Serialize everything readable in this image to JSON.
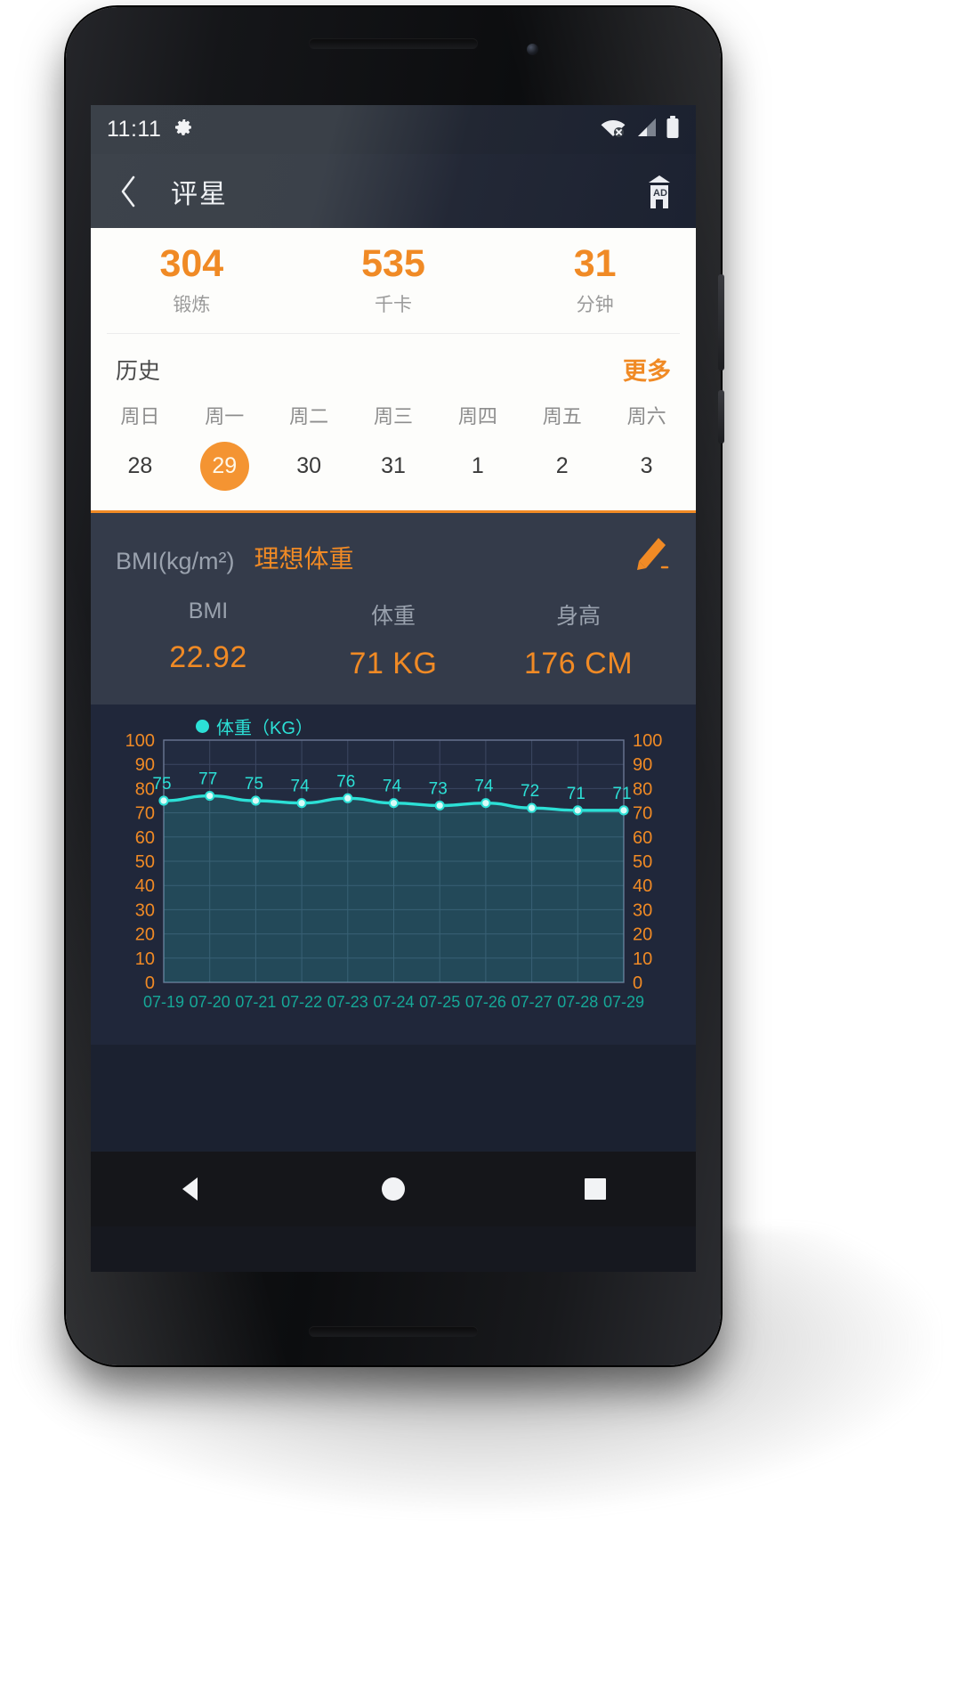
{
  "status_bar": {
    "time": "11:11",
    "gear_icon": "gear-icon",
    "wifi_icon": "wifi-off-icon",
    "signal_icon": "signal-bars-icon",
    "battery_icon": "battery-icon"
  },
  "app_bar": {
    "back_icon": "back-chevron-icon",
    "title": "评星",
    "ad_icon": "ad-badge-icon"
  },
  "summary": {
    "stats": [
      {
        "value": "304",
        "label": "锻炼"
      },
      {
        "value": "535",
        "label": "千卡"
      },
      {
        "value": "31",
        "label": "分钟"
      }
    ]
  },
  "history": {
    "title": "历史",
    "more_label": "更多",
    "weekdays": [
      "周日",
      "周一",
      "周二",
      "周三",
      "周四",
      "周五",
      "周六"
    ],
    "dates": [
      "28",
      "29",
      "30",
      "31",
      "1",
      "2",
      "3"
    ],
    "selected_index": 1
  },
  "bmi": {
    "unit_label": "BMI(kg/m²)",
    "ideal_label": "理想体重",
    "edit_icon": "pencil-edit-icon",
    "columns": [
      {
        "label": "BMI",
        "value": "22.92"
      },
      {
        "label": "体重",
        "value": "71 KG"
      },
      {
        "label": "身高",
        "value": "176 CM"
      }
    ]
  },
  "nav_bar": {
    "back_icon": "nav-back-triangle-icon",
    "home_icon": "nav-home-circle-icon",
    "recents_icon": "nav-recents-square-icon"
  },
  "colors": {
    "accent_orange": "#f08a25",
    "chart_cyan": "#2ce0d6",
    "panel_dark": "#343b4a",
    "chart_bg": "#20273a"
  },
  "chart_data": {
    "type": "area",
    "title": "",
    "series": [
      {
        "name": "体重（KG）",
        "color": "#2ce0d6",
        "values": [
          75,
          77,
          75,
          74,
          76,
          74,
          73,
          74,
          72,
          71,
          71
        ]
      }
    ],
    "categories": [
      "07-19",
      "07-20",
      "07-21",
      "07-22",
      "07-23",
      "07-24",
      "07-25",
      "07-26",
      "07-27",
      "07-28",
      "07-29"
    ],
    "legend": [
      "体重（KG）"
    ],
    "legend_position": "top-left",
    "xlabel": "",
    "ylabel": "",
    "ylim": [
      0,
      100
    ],
    "yticks": [
      0,
      10,
      20,
      30,
      40,
      50,
      60,
      70,
      80,
      90,
      100
    ],
    "ytick_labels_left": [
      "100",
      "90",
      "80",
      "70",
      "60",
      "50",
      "40",
      "30",
      "20",
      "10",
      "0"
    ],
    "ytick_labels_right": [
      "100",
      "90",
      "80",
      "70",
      "60",
      "50",
      "40",
      "30",
      "20",
      "10",
      "0"
    ],
    "grid": true,
    "point_labels": [
      "75",
      "77",
      "75",
      "74",
      "76",
      "74",
      "73",
      "74",
      "72",
      "71",
      "71"
    ]
  }
}
